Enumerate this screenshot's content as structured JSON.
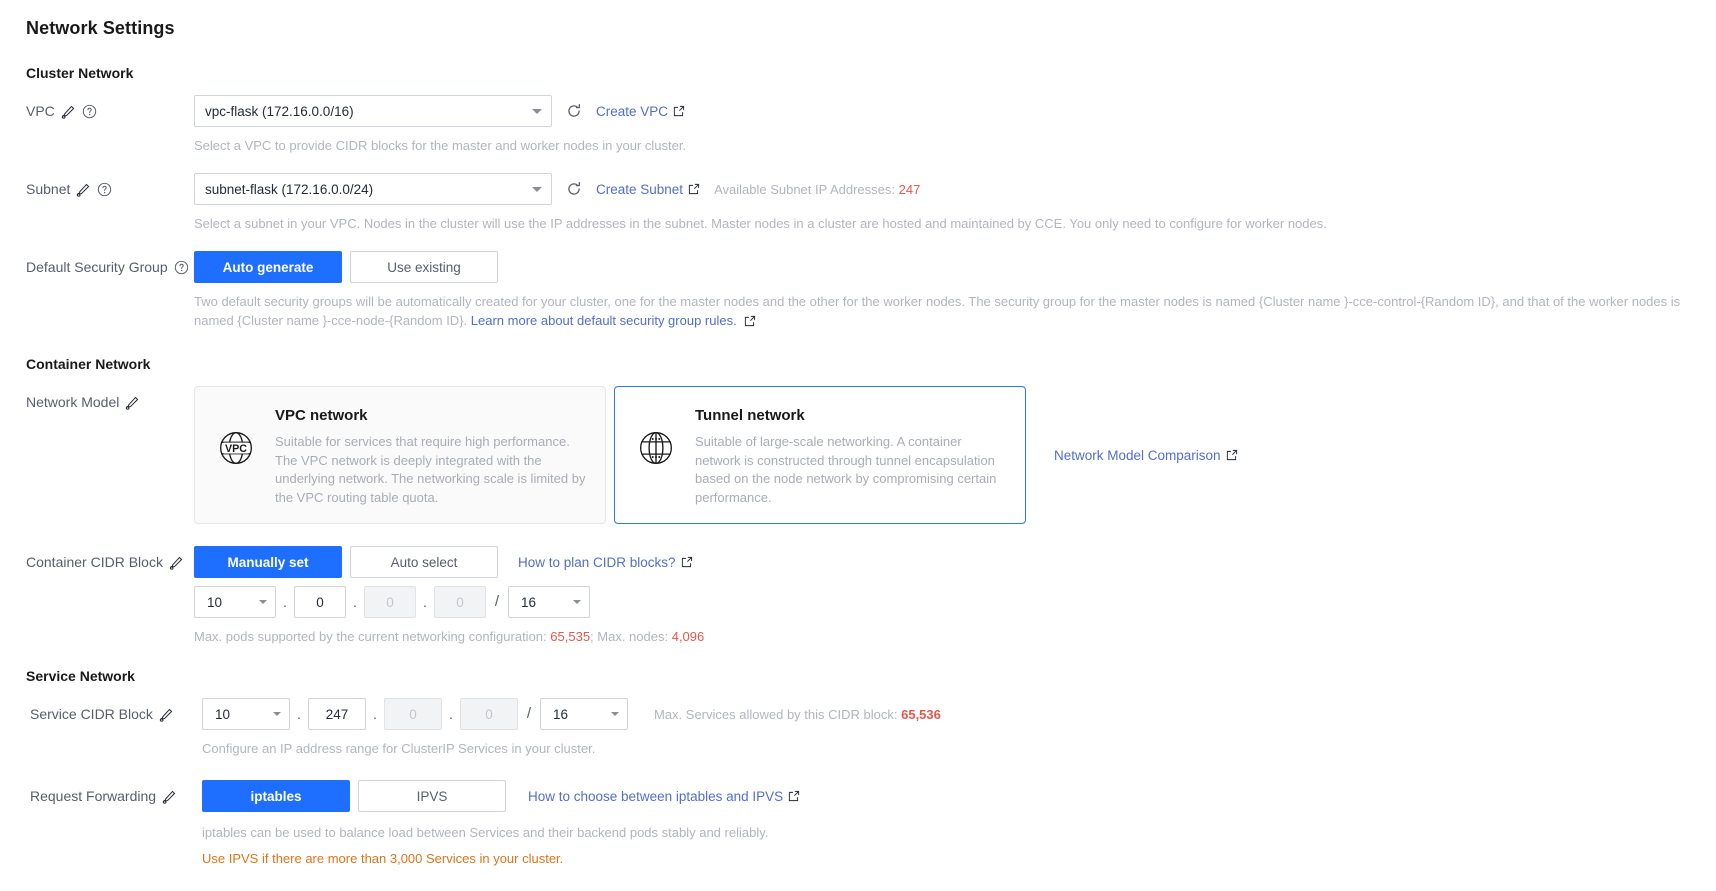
{
  "page": {
    "title": "Network Settings"
  },
  "sections": {
    "cluster_network": {
      "title": "Cluster Network"
    },
    "container_network": {
      "title": "Container Network"
    },
    "service_network": {
      "title": "Service Network"
    }
  },
  "vpc": {
    "label": "VPC",
    "value": "vpc-flask (172.16.0.0/16)",
    "refresh_icon": "refresh-icon",
    "create_link": "Create VPC",
    "hint": "Select a VPC to provide CIDR blocks for the master and worker nodes in your cluster."
  },
  "subnet": {
    "label": "Subnet",
    "value": "subnet-flask (172.16.0.0/24)",
    "refresh_icon": "refresh-icon",
    "create_link": "Create Subnet",
    "available_label": "Available Subnet IP Addresses:",
    "available_value": "247",
    "hint": "Select a subnet in your VPC. Nodes in the cluster will use the IP addresses in the subnet. Master nodes in a cluster are hosted and maintained by CCE. You only need to configure for worker nodes."
  },
  "security_group": {
    "label": "Default Security Group",
    "options": [
      "Auto generate",
      "Use existing"
    ],
    "selected": "Auto generate",
    "hint_part1": "Two default security groups will be automatically created for your cluster, one for the master nodes and the other for the worker nodes. The security group for the master nodes is named {Cluster name }-cce-control-{Random ID}, and that of the worker nodes is named {Cluster name }-cce-node-{Random ID}.",
    "hint_link": "Learn more about default security group rules."
  },
  "network_model": {
    "label": "Network Model",
    "cards": [
      {
        "id": "vpc-network",
        "title": "VPC network",
        "description": "Suitable for services that require high performance. The VPC network is deeply integrated with the underlying network. The networking scale is limited by the VPC routing table quota.",
        "icon": "vpc-globe-icon",
        "selected": false
      },
      {
        "id": "tunnel-network",
        "title": "Tunnel network",
        "description": "Suitable of large-scale networking. A container network is constructed through tunnel encapsulation based on the node network by compromising certain performance.",
        "icon": "tunnel-globe-icon",
        "selected": true
      }
    ],
    "comparison_link": "Network Model Comparison"
  },
  "container_cidr": {
    "label": "Container CIDR Block",
    "options": [
      "Manually set",
      "Auto select"
    ],
    "selected": "Manually set",
    "plan_link": "How to plan CIDR blocks?",
    "octets": [
      {
        "value": "10",
        "type": "select",
        "disabled": false
      },
      {
        "value": "0",
        "type": "input",
        "disabled": false
      },
      {
        "value": "0",
        "type": "input",
        "disabled": true
      },
      {
        "value": "0",
        "type": "input",
        "disabled": true
      }
    ],
    "mask": {
      "value": "16",
      "type": "select"
    },
    "hint_prefix": "Max. pods supported by the current networking configuration:",
    "max_pods": "65,535",
    "hint_mid": "; Max. nodes:",
    "max_nodes": "4,096"
  },
  "service_cidr": {
    "label": "Service CIDR Block",
    "octets": [
      {
        "value": "10",
        "type": "select",
        "disabled": false
      },
      {
        "value": "247",
        "type": "input",
        "disabled": false
      },
      {
        "value": "0",
        "type": "input",
        "disabled": true
      },
      {
        "value": "0",
        "type": "input",
        "disabled": true
      }
    ],
    "mask": {
      "value": "16",
      "type": "select"
    },
    "max_services_label": "Max. Services allowed by this CIDR block:",
    "max_services_value": "65,536",
    "hint": "Configure an IP address range for ClusterIP Services in your cluster."
  },
  "request_forwarding": {
    "label": "Request Forwarding",
    "options": [
      "iptables",
      "IPVS"
    ],
    "selected": "iptables",
    "choose_link": "How to choose between iptables and IPVS",
    "hint": "iptables can be used to balance load between Services and their backend pods stably and reliably.",
    "warning": "Use IPVS if there are more than 3,000 Services in your cluster."
  },
  "colors": {
    "accent": "#1e6fff",
    "link": "#526ecc",
    "warning": "#e37318",
    "danger": "#e8574b",
    "muted": "#b1b5c0"
  },
  "dot_separator": ".",
  "slash_separator": "/"
}
